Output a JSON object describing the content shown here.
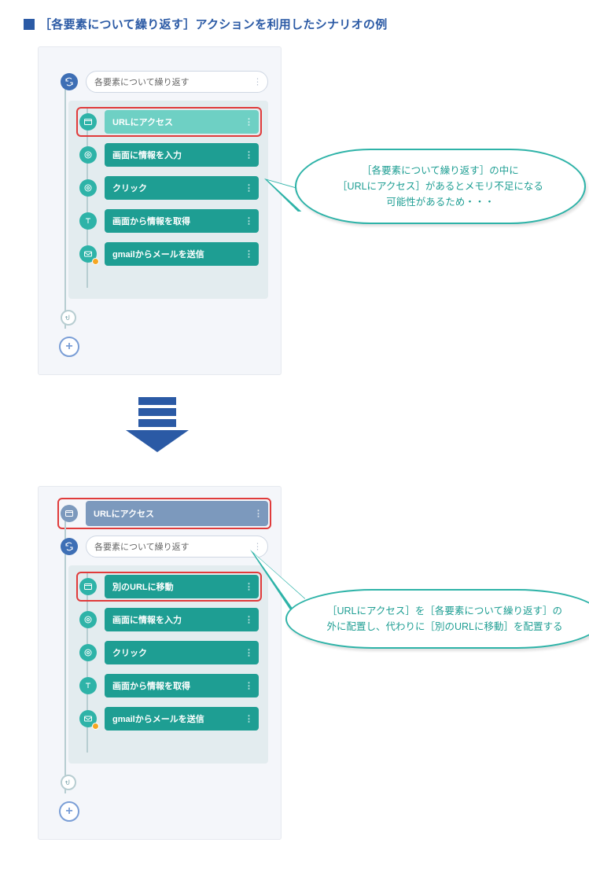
{
  "heading": "［各要素について繰り返す］アクションを利用したシナリオの例",
  "panel1": {
    "loop_label": "各要素について繰り返す",
    "items": [
      {
        "icon": "browser",
        "label": "URLにアクセス",
        "variant": "light",
        "highlight": true
      },
      {
        "icon": "target",
        "label": "画面に情報を入力",
        "variant": "teal"
      },
      {
        "icon": "target",
        "label": "クリック",
        "variant": "teal"
      },
      {
        "icon": "text",
        "label": "画面から情報を取得",
        "variant": "teal"
      },
      {
        "icon": "mail",
        "label": "gmailからメールを送信",
        "variant": "teal",
        "badge": true
      }
    ]
  },
  "panel2": {
    "top_bar": {
      "icon": "browser",
      "label": "URLにアクセス",
      "variant": "steel",
      "highlight": true
    },
    "loop_label": "各要素について繰り返す",
    "items": [
      {
        "icon": "browser",
        "label": "別のURLに移動",
        "variant": "teal",
        "highlight": true
      },
      {
        "icon": "target",
        "label": "画面に情報を入力",
        "variant": "teal"
      },
      {
        "icon": "target",
        "label": "クリック",
        "variant": "teal"
      },
      {
        "icon": "text",
        "label": "画面から情報を取得",
        "variant": "teal"
      },
      {
        "icon": "mail",
        "label": "gmailからメールを送信",
        "variant": "teal",
        "badge": true
      }
    ]
  },
  "callout1": "［各要素について繰り返す］の中に\n［URLにアクセス］があるとメモリ不足になる\n可能性があるため・・・",
  "callout2": "［URLにアクセス］を［各要素について繰り返す］の\n外に配置し、代わりに［別のURLに移動］を配置する"
}
